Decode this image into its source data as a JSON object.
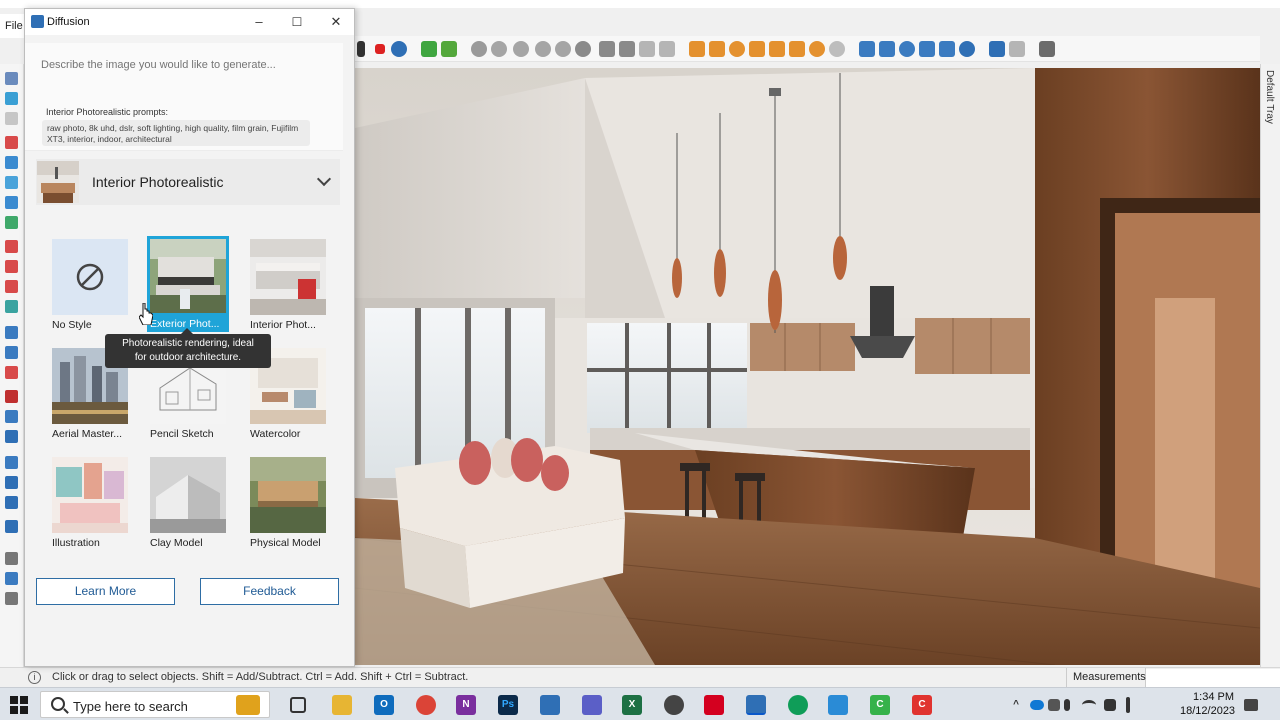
{
  "app": {
    "file_menu": "File",
    "default_tray": "Default Tray",
    "status_text": "Click or drag to select objects. Shift = Add/Subtract. Ctrl = Add. Shift + Ctrl = Subtract.",
    "measurements_label": "Measurements",
    "measurements_value": ""
  },
  "diffusion": {
    "title": "Diffusion",
    "prompt_placeholder": "Describe the image you would like to generate...",
    "prompt_heading": "Interior Photorealistic prompts:",
    "prompt_suggestion": "raw photo, 8k uhd, dslr, soft lighting, high quality, film grain, Fujifilm XT3, interior, indoor, architectural",
    "selected_style": "Interior Photorealistic",
    "styles": [
      {
        "label": "No Style"
      },
      {
        "label": "Exterior Phot..."
      },
      {
        "label": "Interior Phot..."
      },
      {
        "label": "Aerial Master..."
      },
      {
        "label": "Pencil Sketch"
      },
      {
        "label": "Watercolor"
      },
      {
        "label": "Illustration"
      },
      {
        "label": "Clay Model"
      },
      {
        "label": "Physical Model"
      }
    ],
    "tooltip_line1": "Photorealistic rendering, ideal",
    "tooltip_line2": "for outdoor architecture.",
    "learn_more": "Learn More",
    "feedback": "Feedback",
    "window_controls": {
      "minimize": "–",
      "maximize": "☐",
      "close": "✕"
    }
  },
  "taskbar": {
    "search_placeholder": "Type here to search",
    "time": "1:34 PM",
    "date": "18/12/2023"
  },
  "colors": {
    "accent": "#1fa4d8",
    "button_border": "#2e6da4"
  }
}
